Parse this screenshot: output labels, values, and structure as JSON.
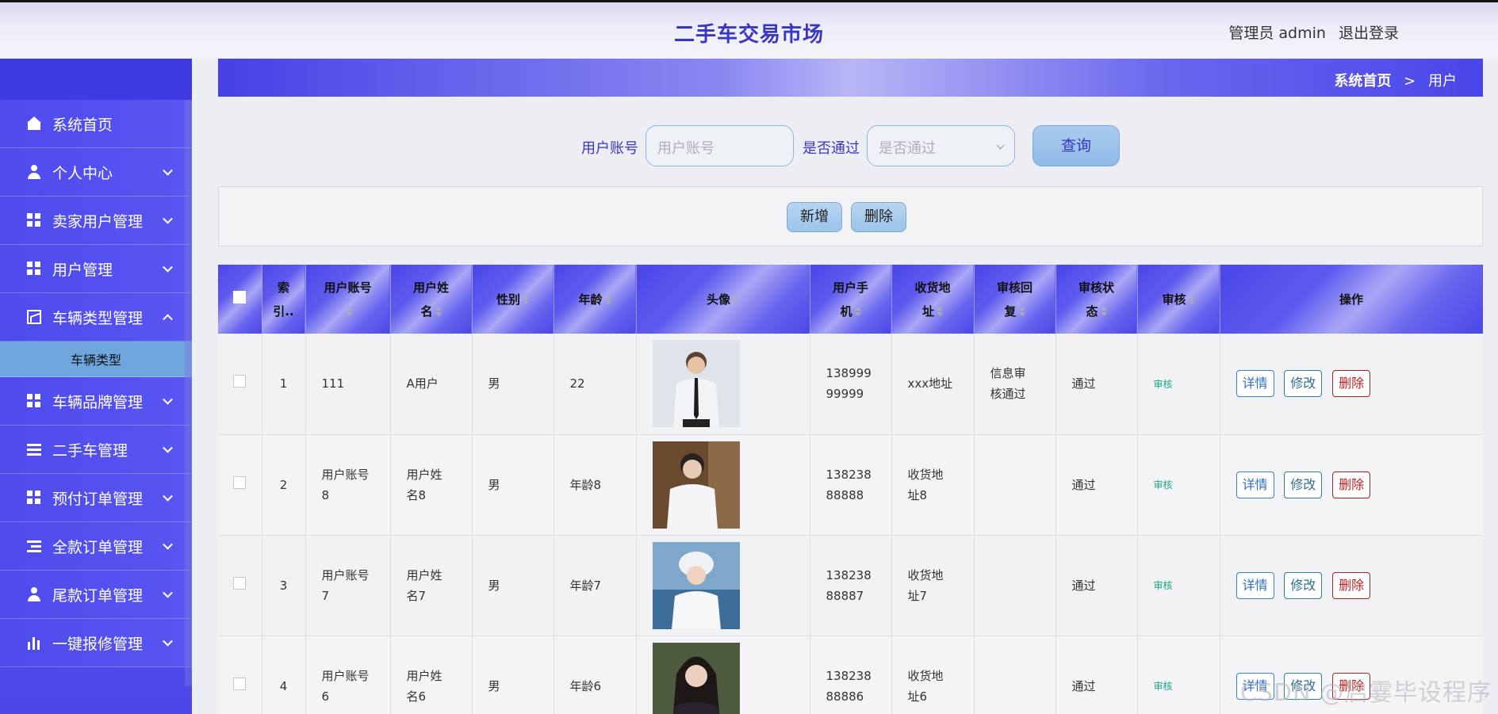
{
  "header": {
    "title": "二手车交易市场",
    "user_label": "管理员 admin",
    "logout_label": "退出登录"
  },
  "sidebar": {
    "items": [
      {
        "label": "系统首页",
        "icon": "home-icon"
      },
      {
        "label": "个人中心",
        "icon": "user-icon"
      },
      {
        "label": "卖家用户管理",
        "icon": "grid-icon"
      },
      {
        "label": "用户管理",
        "icon": "grid-icon"
      },
      {
        "label": "车辆类型管理",
        "icon": "chart-icon",
        "expanded": true
      },
      {
        "label": "车辆品牌管理",
        "icon": "grid-icon"
      },
      {
        "label": "二手车管理",
        "icon": "list-icon"
      },
      {
        "label": "预付订单管理",
        "icon": "grid-icon"
      },
      {
        "label": "全款订单管理",
        "icon": "list-indent-icon"
      },
      {
        "label": "尾款订单管理",
        "icon": "user-icon"
      },
      {
        "label": "一键报修管理",
        "icon": "bar-chart-icon"
      }
    ],
    "submenu": {
      "label": "车辆类型"
    }
  },
  "breadcrumb": {
    "home": "系统首页",
    "separator": ">",
    "current": "用户"
  },
  "search": {
    "account_label": "用户账号",
    "account_placeholder": "用户账号",
    "pass_label": "是否通过",
    "pass_placeholder": "是否通过",
    "query_button": "查询"
  },
  "actions": {
    "add": "新增",
    "delete": "删除"
  },
  "table": {
    "headers": [
      "索引",
      "用户账号",
      "用户姓名",
      "性别",
      "年龄",
      "头像",
      "用户手机",
      "收货地址",
      "审核回复",
      "审核状态",
      "审核",
      "操作"
    ],
    "header_display": {
      "index": "索\n引..",
      "account": "用户账号",
      "name": "用户姓\n名",
      "gender": "性别",
      "age": "年龄",
      "avatar": "头像",
      "phone": "用户手\n机",
      "address": "收货地\n址",
      "reply": "审核回\n复",
      "status": "审核状\n态",
      "audit": "审核",
      "ops": "操作"
    },
    "rows": [
      {
        "index": "1",
        "account": "111",
        "name": "A用户",
        "gender": "男",
        "age": "22",
        "phone": "138999\n99999",
        "address": "xxx地址",
        "reply": "信息审\n核通过",
        "status": "通过",
        "audit": "审核"
      },
      {
        "index": "2",
        "account": "用户账号\n8",
        "name": "用户姓\n名8",
        "gender": "男",
        "age": "年龄8",
        "phone": "138238\n88888",
        "address": "收货地\n址8",
        "reply": "",
        "status": "通过",
        "audit": "审核"
      },
      {
        "index": "3",
        "account": "用户账号\n7",
        "name": "用户姓\n名7",
        "gender": "男",
        "age": "年龄7",
        "phone": "138238\n88887",
        "address": "收货地\n址7",
        "reply": "",
        "status": "通过",
        "audit": "审核"
      },
      {
        "index": "4",
        "account": "用户账号\n6",
        "name": "用户姓\n名6",
        "gender": "男",
        "age": "年龄6",
        "phone": "138238\n88886",
        "address": "收货地\n址6",
        "reply": "",
        "status": "通过",
        "audit": "审核"
      }
    ],
    "row_ops": {
      "detail": "详情",
      "edit": "修改",
      "delete": "删除"
    }
  },
  "watermark": "CSDN @启霎毕设程序",
  "colors": {
    "accent": "#4b47ea",
    "title": "#3a37c5",
    "audit": "#1aa58a"
  }
}
